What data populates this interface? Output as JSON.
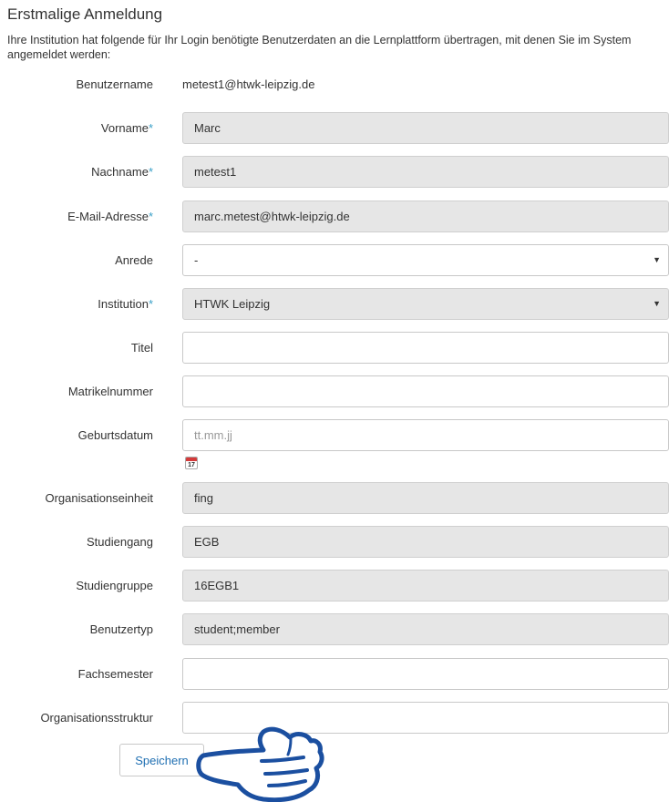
{
  "page": {
    "title": "Erstmalige Anmeldung",
    "intro": "Ihre Institution hat folgende für Ihr Login benötigte Benutzerdaten an die Lernplattform übertragen, mit denen Sie im System angemeldet werden:"
  },
  "form": {
    "username": {
      "label": "Benutzername",
      "value": "metest1@htwk-leipzig.de"
    },
    "firstname": {
      "label": "Vorname",
      "required_mark": "*",
      "value": "Marc"
    },
    "lastname": {
      "label": "Nachname",
      "required_mark": "*",
      "value": "metest1"
    },
    "email": {
      "label": "E-Mail-Adresse",
      "required_mark": "*",
      "value": "marc.metest@htwk-leipzig.de"
    },
    "salutation": {
      "label": "Anrede",
      "value": "-",
      "arrow": "▼"
    },
    "institution": {
      "label": "Institution",
      "required_mark": "*",
      "value": "HTWK Leipzig",
      "arrow": "▼"
    },
    "title_field": {
      "label": "Titel",
      "value": ""
    },
    "matriculation": {
      "label": "Matrikelnummer",
      "value": ""
    },
    "birthdate": {
      "label": "Geburtsdatum",
      "placeholder": "tt.mm.jj",
      "calendar_day": "17",
      "calendar_icon": "calendar-icon"
    },
    "org_unit": {
      "label": "Organisationseinheit",
      "value": "fing"
    },
    "study_program": {
      "label": "Studiengang",
      "value": "EGB"
    },
    "study_group": {
      "label": "Studiengruppe",
      "value": "16EGB1"
    },
    "user_type": {
      "label": "Benutzertyp",
      "value": "student;member"
    },
    "semester": {
      "label": "Fachsemester",
      "value": ""
    },
    "org_structure": {
      "label": "Organisationsstruktur",
      "value": ""
    }
  },
  "actions": {
    "save_label": "Speichern"
  },
  "cursor_icon": "pointing-hand-icon",
  "colors": {
    "required_asterisk": "#3aa0c8",
    "link_blue": "#1f6fb2",
    "readonly_bg": "#e6e6e6"
  }
}
